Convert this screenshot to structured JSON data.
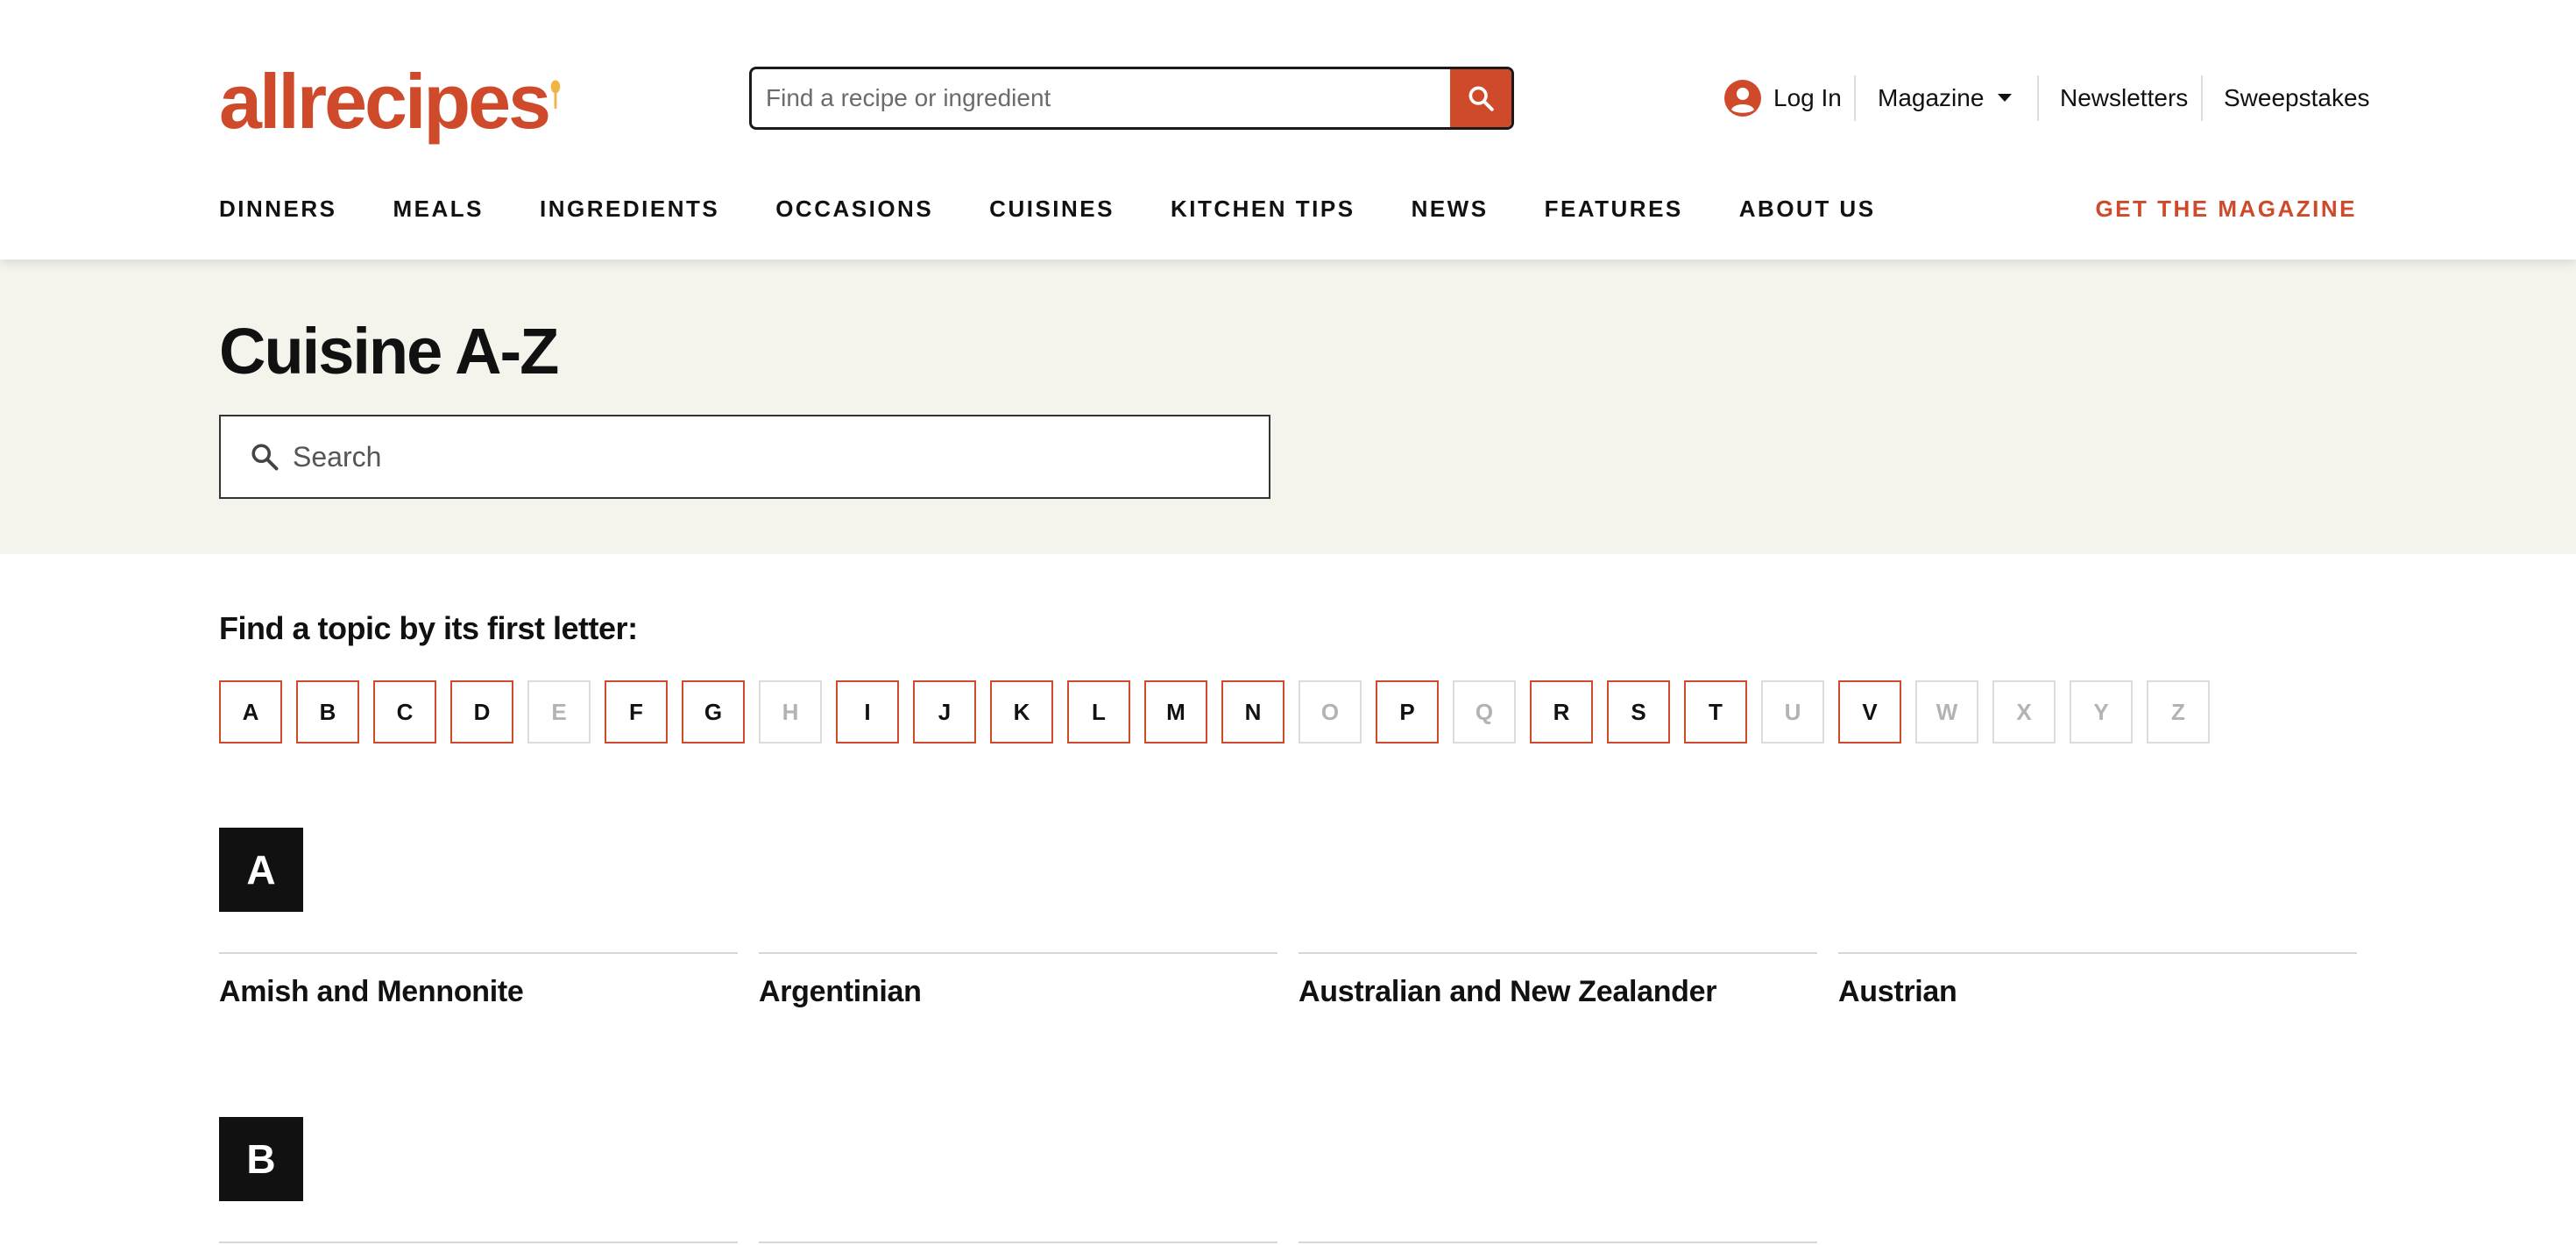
{
  "header": {
    "logo_text": "allrecipes",
    "search_placeholder": "Find a recipe or ingredient",
    "login_label": "Log In",
    "magazine_label": "Magazine",
    "newsletters_label": "Newsletters",
    "sweepstakes_label": "Sweepstakes",
    "nav": [
      "DINNERS",
      "MEALS",
      "INGREDIENTS",
      "OCCASIONS",
      "CUISINES",
      "KITCHEN TIPS",
      "NEWS",
      "FEATURES",
      "ABOUT US"
    ],
    "get_magazine_label": "GET THE MAGAZINE"
  },
  "hero": {
    "title": "Cuisine A-Z",
    "search_placeholder": "Search"
  },
  "finder": {
    "label": "Find a topic by its first letter:",
    "letters": [
      {
        "letter": "A",
        "enabled": true
      },
      {
        "letter": "B",
        "enabled": true
      },
      {
        "letter": "C",
        "enabled": true
      },
      {
        "letter": "D",
        "enabled": true
      },
      {
        "letter": "E",
        "enabled": false
      },
      {
        "letter": "F",
        "enabled": true
      },
      {
        "letter": "G",
        "enabled": true
      },
      {
        "letter": "H",
        "enabled": false
      },
      {
        "letter": "I",
        "enabled": true
      },
      {
        "letter": "J",
        "enabled": true
      },
      {
        "letter": "K",
        "enabled": true
      },
      {
        "letter": "L",
        "enabled": true
      },
      {
        "letter": "M",
        "enabled": true
      },
      {
        "letter": "N",
        "enabled": true
      },
      {
        "letter": "O",
        "enabled": false
      },
      {
        "letter": "P",
        "enabled": true
      },
      {
        "letter": "Q",
        "enabled": false
      },
      {
        "letter": "R",
        "enabled": true
      },
      {
        "letter": "S",
        "enabled": true
      },
      {
        "letter": "T",
        "enabled": true
      },
      {
        "letter": "U",
        "enabled": false
      },
      {
        "letter": "V",
        "enabled": true
      },
      {
        "letter": "W",
        "enabled": false
      },
      {
        "letter": "X",
        "enabled": false
      },
      {
        "letter": "Y",
        "enabled": false
      },
      {
        "letter": "Z",
        "enabled": false
      }
    ]
  },
  "sections": [
    {
      "letter": "A",
      "items": [
        "Amish and Mennonite",
        "Argentinian",
        "Australian and New Zealander",
        "Austrian"
      ]
    },
    {
      "letter": "B",
      "items": [
        "",
        "",
        ""
      ]
    }
  ],
  "colors": {
    "brand": "#ce4a2a",
    "spoon": "#f0b442",
    "hero_bg": "#f4f4ec",
    "disabled_border": "#dcdcdc"
  }
}
